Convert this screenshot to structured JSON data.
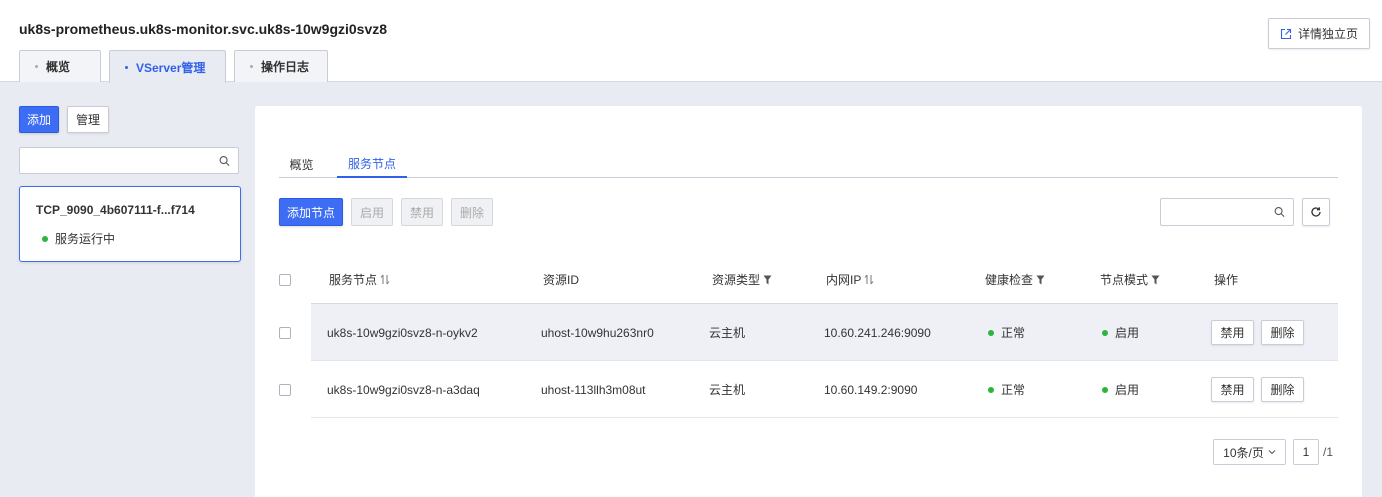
{
  "header": {
    "title": "uk8s-prometheus.uk8s-monitor.svc.uk8s-10w9gzi0svz8",
    "detail_button": "详情独立页",
    "tabs": [
      {
        "label": "概览",
        "active": false
      },
      {
        "label": "VServer管理",
        "active": true
      },
      {
        "label": "操作日志",
        "active": false
      }
    ]
  },
  "sidebar": {
    "add_button": "添加",
    "manage_button": "管理",
    "search_placeholder": "",
    "vserver": {
      "name": "TCP_9090_4b607111-f...f714",
      "status": "服务运行中",
      "status_color": "#2bb53c"
    }
  },
  "main": {
    "tabs": [
      {
        "label": "概览",
        "active": false
      },
      {
        "label": "服务节点",
        "active": true
      }
    ],
    "toolbar": {
      "add_node": "添加节点",
      "enable": "启用",
      "disable": "禁用",
      "delete": "删除",
      "search_placeholder": ""
    },
    "table": {
      "columns": [
        "服务节点",
        "资源ID",
        "资源类型",
        "内网IP",
        "健康检查",
        "节点模式",
        "操作"
      ],
      "rows": [
        {
          "node": "uk8s-10w9gzi0svz8-n-oykv2",
          "resource_id": "uhost-10w9hu263nr0",
          "resource_type": "云主机",
          "ip": "10.60.241.246:9090",
          "health": "正常",
          "mode": "启用",
          "action_disable": "禁用",
          "action_delete": "删除"
        },
        {
          "node": "uk8s-10w9gzi0svz8-n-a3daq",
          "resource_id": "uhost-113llh3m08ut",
          "resource_type": "云主机",
          "ip": "10.60.149.2:9090",
          "health": "正常",
          "mode": "启用",
          "action_disable": "禁用",
          "action_delete": "删除"
        }
      ]
    },
    "pagination": {
      "page_size": "10条/页",
      "current_page": "1",
      "total": "/1"
    }
  },
  "colors": {
    "accent": "#3d6cf5",
    "status_green": "#2bb53c"
  }
}
